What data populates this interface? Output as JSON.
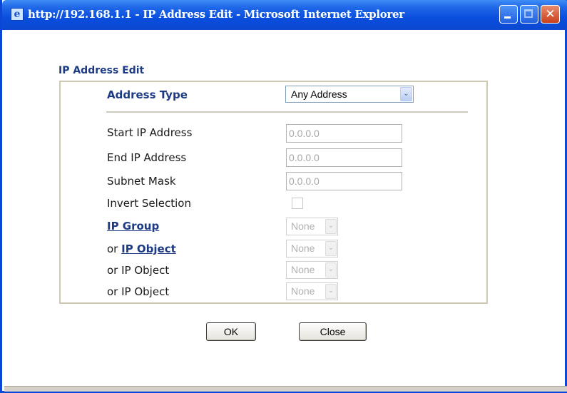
{
  "window": {
    "title": "http://192.168.1.1 - IP Address Edit - Microsoft Internet Explorer",
    "close_glyph": "✕"
  },
  "form": {
    "section_title": "IP Address Edit",
    "address_type": {
      "label": "Address Type",
      "value": "Any Address"
    },
    "start_ip": {
      "label": "Start IP Address",
      "value": "0.0.0.0"
    },
    "end_ip": {
      "label": "End IP Address",
      "value": "0.0.0.0"
    },
    "subnet_mask": {
      "label": "Subnet Mask",
      "value": "0.0.0.0"
    },
    "invert_selection": {
      "label": "Invert Selection",
      "checked": false
    },
    "ip_group": {
      "label": "IP Group",
      "value": "None"
    },
    "ip_object_1": {
      "prefix": "or ",
      "label": "IP Object",
      "value": "None"
    },
    "ip_object_2": {
      "label": "or IP Object",
      "value": "None"
    },
    "ip_object_3": {
      "label": "or IP Object",
      "value": "None"
    },
    "dropdown_glyph": "⌄"
  },
  "buttons": {
    "ok": "OK",
    "close": "Close"
  }
}
